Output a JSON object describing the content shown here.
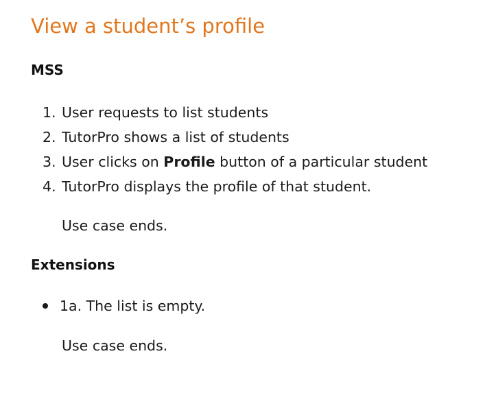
{
  "title": "View a student’s profile",
  "mss": {
    "heading": "MSS",
    "steps": [
      {
        "num": "1.",
        "text": "User requests to list students"
      },
      {
        "num": "2.",
        "text": "TutorPro shows a list of students"
      },
      {
        "num": "3.",
        "pre": "User clicks on ",
        "bold": "Profile",
        "post": " button of a particular student"
      },
      {
        "num": "4.",
        "text": "TutorPro displays the profile of that student."
      }
    ],
    "end_note": "Use case ends."
  },
  "extensions": {
    "heading": "Extensions",
    "items": [
      {
        "text": "1a. The list is empty.",
        "end_note": "Use case ends."
      }
    ]
  },
  "colors": {
    "title": "#e2761c"
  }
}
